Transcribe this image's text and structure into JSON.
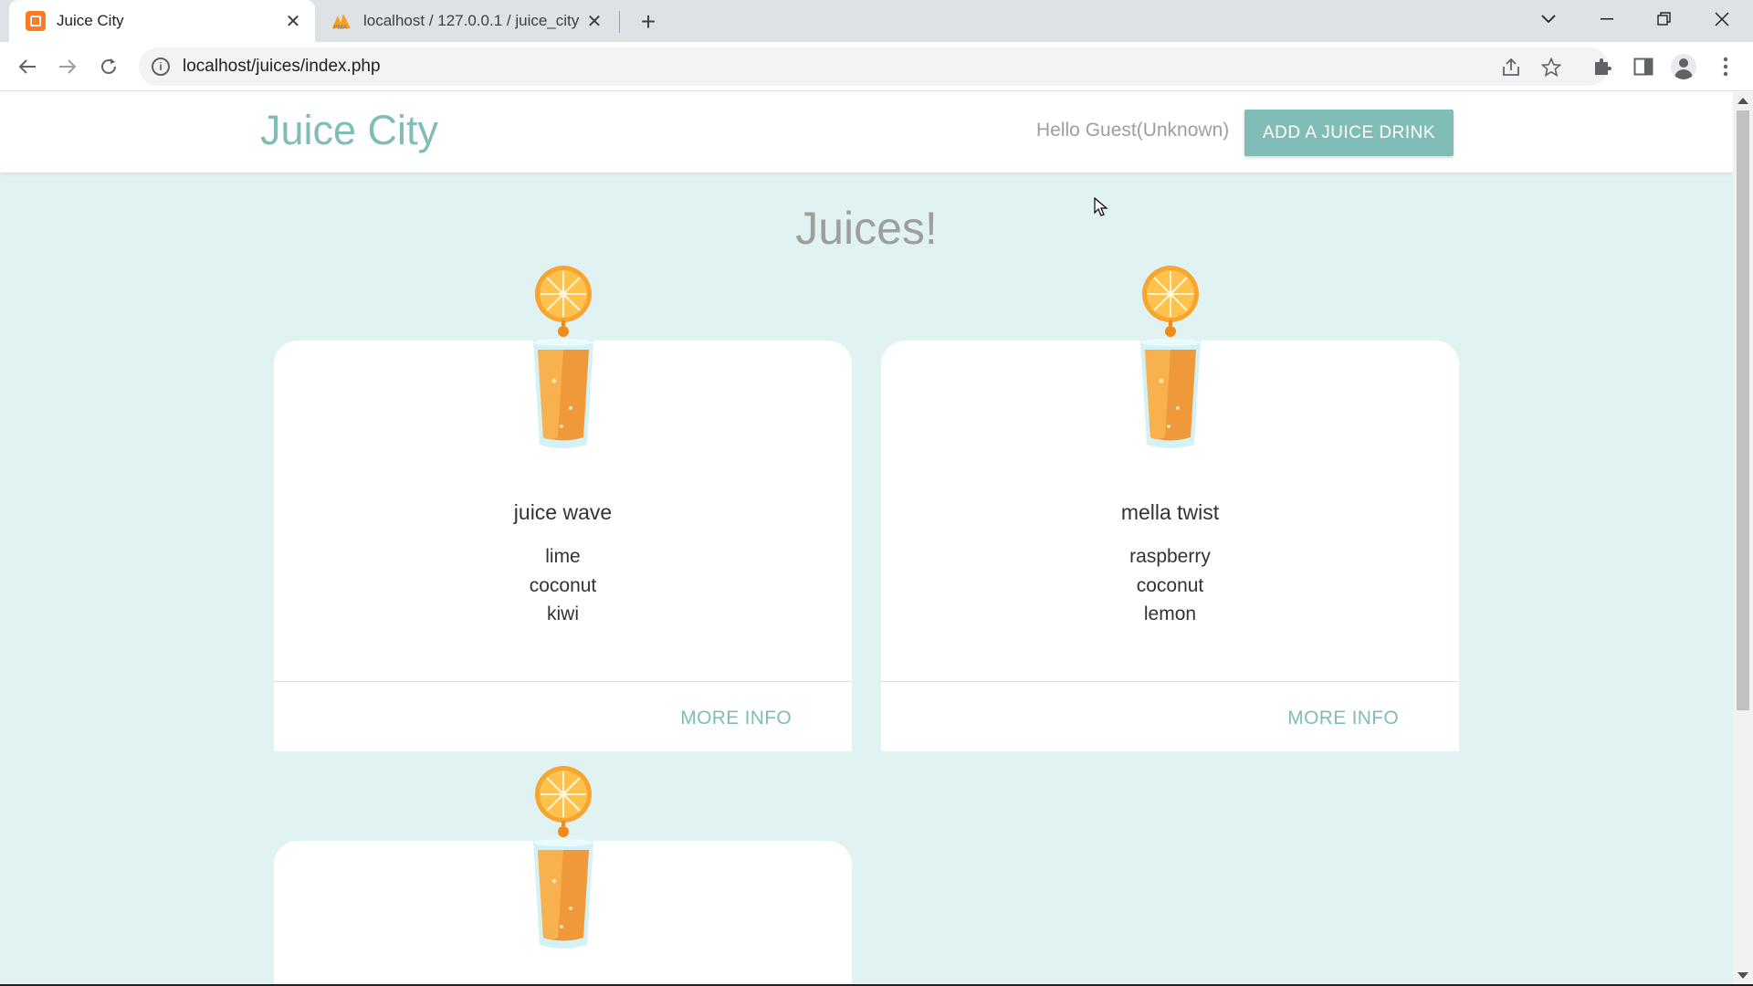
{
  "browser": {
    "tabs": [
      {
        "title": "Juice City",
        "active": true
      },
      {
        "title": "localhost / 127.0.0.1 / juice_city /",
        "active": false
      }
    ],
    "url": "localhost/juices/index.php"
  },
  "page": {
    "brand": "Juice City",
    "greeting": "Hello Guest(Unknown)",
    "add_button": "ADD A JUICE DRINK",
    "heading": "Juices!",
    "juices": [
      {
        "name": "juice wave",
        "ingredients": [
          "lime",
          "coconut",
          "kiwi"
        ],
        "action": "MORE INFO"
      },
      {
        "name": "mella twist",
        "ingredients": [
          "raspberry",
          "coconut",
          "lemon"
        ],
        "action": "MORE INFO"
      }
    ]
  },
  "colors": {
    "accent": "#80bdb6",
    "page_background": "#e0f2f1",
    "juice_orange": "#f0a040"
  },
  "icons": [
    "juice-glass-icon",
    "orange-slice-icon",
    "info-icon",
    "share-icon",
    "star-icon",
    "extensions-icon",
    "side-panel-icon",
    "profile-icon"
  ]
}
